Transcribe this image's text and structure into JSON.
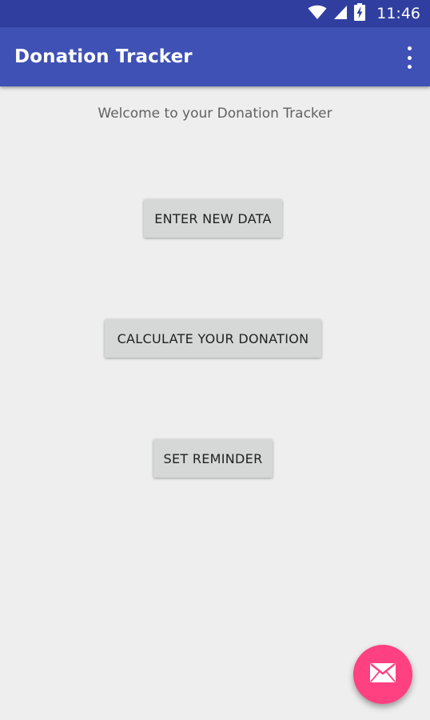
{
  "status_bar": {
    "time": "11:46",
    "icons": [
      "wifi-icon",
      "cell-signal-icon",
      "battery-charging-icon"
    ]
  },
  "app_bar": {
    "title": "Donation Tracker",
    "menu_icon": "overflow-menu-icon"
  },
  "main": {
    "welcome_text": "Welcome to your Donation Tracker",
    "buttons": {
      "enter_new_data": "ENTER NEW DATA",
      "calculate_donation": "CALCULATE YOUR DONATION",
      "set_reminder": "SET REMINDER"
    }
  },
  "fab": {
    "icon": "email-icon"
  },
  "colors": {
    "status_bar": "#303f9f",
    "app_bar": "#3f51b5",
    "background": "#eeeeee",
    "button": "#d6d7d7",
    "fab": "#ff4081"
  }
}
